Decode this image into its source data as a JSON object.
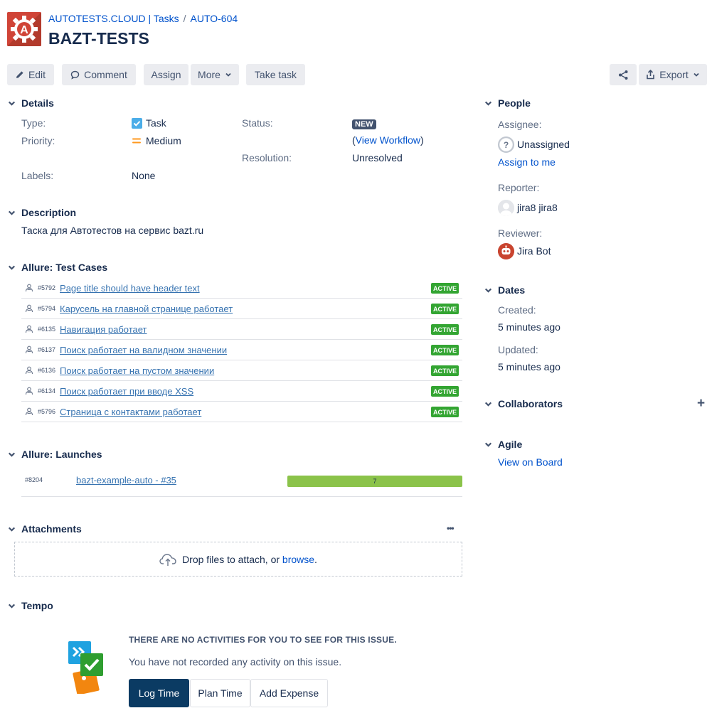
{
  "header": {
    "project": "AUTOTESTS.CLOUD | Tasks",
    "separator": "/",
    "issue_key": "AUTO-604",
    "title": "BAZT-TESTS"
  },
  "toolbar": {
    "edit": "Edit",
    "comment": "Comment",
    "assign": "Assign",
    "more": "More",
    "take_task": "Take task",
    "export": "Export"
  },
  "details": {
    "heading": "Details",
    "type_label": "Type:",
    "type_value": "Task",
    "priority_label": "Priority:",
    "priority_value": "Medium",
    "labels_label": "Labels:",
    "labels_value": "None",
    "status_label": "Status:",
    "status_value": "NEW",
    "workflow_open": "(",
    "workflow_link": "View Workflow",
    "workflow_close": ")",
    "resolution_label": "Resolution:",
    "resolution_value": "Unresolved"
  },
  "description": {
    "heading": "Description",
    "text": "Таска для Автотестов на сервис bazt.ru"
  },
  "test_cases": {
    "heading": "Allure: Test Cases",
    "items": [
      {
        "id": "#5792",
        "title": "Page title should have header text",
        "status": "ACTIVE"
      },
      {
        "id": "#5794",
        "title": "Карусель на главной странице работает",
        "status": "ACTIVE"
      },
      {
        "id": "#6135",
        "title": "Навигация работает",
        "status": "ACTIVE"
      },
      {
        "id": "#6137",
        "title": "Поиск работает на валидном значении",
        "status": "ACTIVE"
      },
      {
        "id": "#6136",
        "title": "Поиск работает на пустом значении",
        "status": "ACTIVE"
      },
      {
        "id": "#6134",
        "title": "Поиск работает при вводе XSS",
        "status": "ACTIVE"
      },
      {
        "id": "#5796",
        "title": "Страница с контактами работает",
        "status": "ACTIVE"
      }
    ]
  },
  "launches": {
    "heading": "Allure: Launches",
    "id": "#8204",
    "name": "bazt-example-auto - #35",
    "passed_count": "7",
    "passed_fraction": 1.0
  },
  "attachments": {
    "heading": "Attachments",
    "more": "•••",
    "drop_text": "Drop files to attach, or",
    "browse": "browse",
    "period": "."
  },
  "tempo": {
    "heading": "Tempo",
    "empty_title": "THERE ARE NO ACTIVITIES FOR YOU TO SEE FOR THIS ISSUE.",
    "empty_text": "You have not recorded any activity on this issue.",
    "log_time": "Log Time",
    "plan_time": "Plan Time",
    "add_expense": "Add Expense"
  },
  "people": {
    "heading": "People",
    "assignee_label": "Assignee:",
    "assignee_value": "Unassigned",
    "assign_to_me": "Assign to me",
    "reporter_label": "Reporter:",
    "reporter_value": "jira8 jira8",
    "reviewer_label": "Reviewer:",
    "reviewer_value": "Jira Bot"
  },
  "dates": {
    "heading": "Dates",
    "created_label": "Created:",
    "created_value": "5 minutes ago",
    "updated_label": "Updated:",
    "updated_value": "5 minutes ago"
  },
  "collaborators": {
    "heading": "Collaborators",
    "add": "+"
  },
  "agile": {
    "heading": "Agile",
    "view_on_board": "View on Board"
  },
  "colors": {
    "link": "#0052cc",
    "active_badge": "#33a532",
    "launch_bar": "#8bc34a",
    "log_time_bg": "#0b3b63",
    "status_new_bg": "#42526e"
  }
}
